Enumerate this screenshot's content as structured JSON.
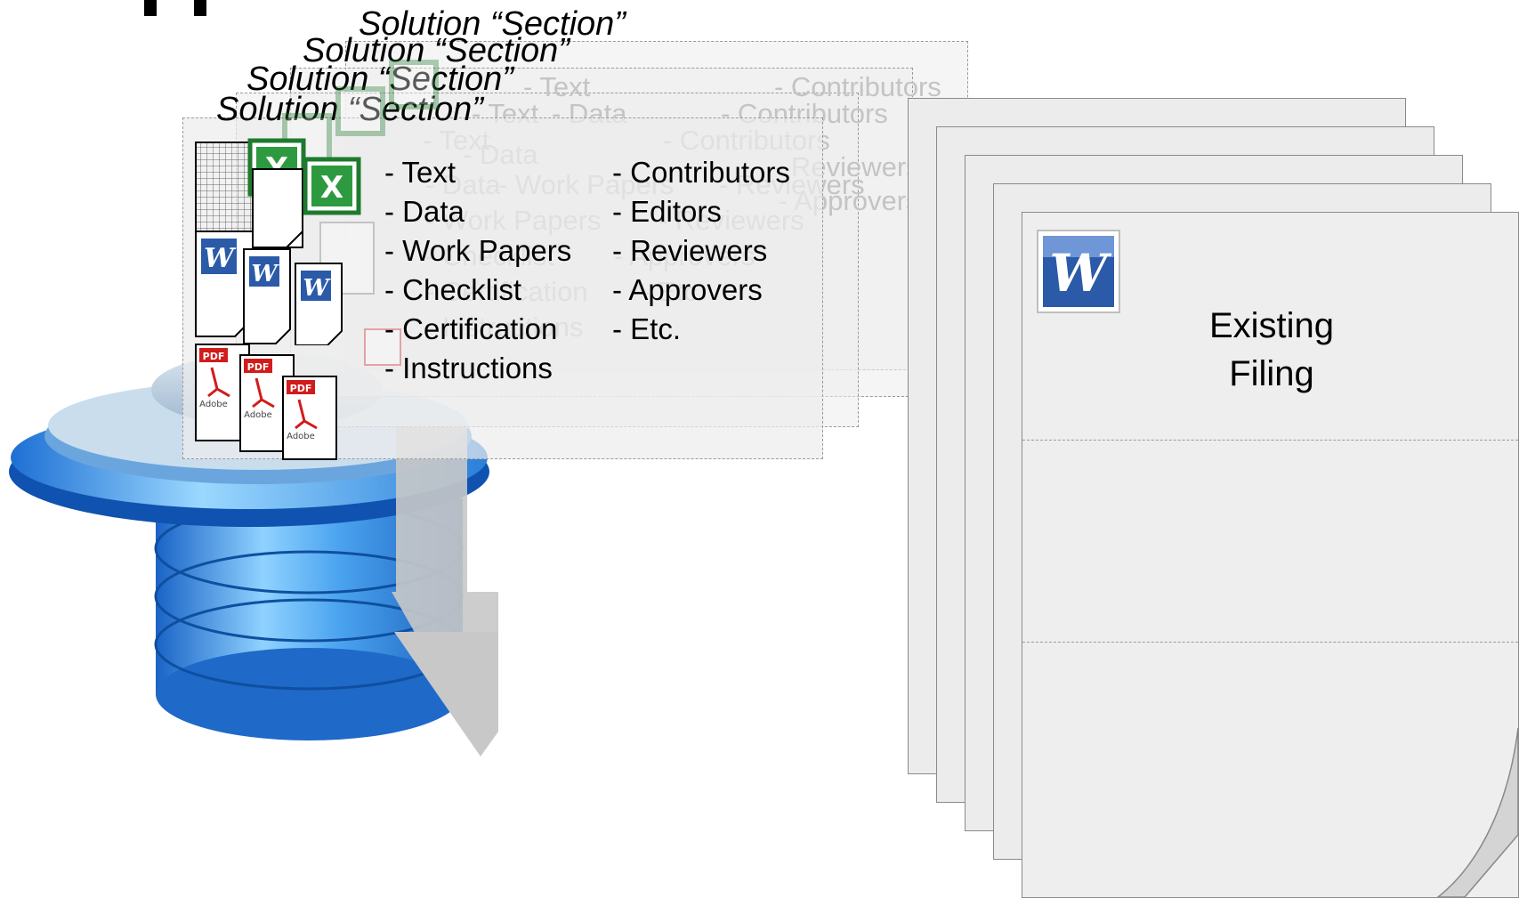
{
  "partial_title": "",
  "section_title": "Solution “Section”",
  "items_left": [
    "- Text",
    "- Data",
    "- Work Papers",
    "- Checklist",
    "- Certification",
    "- Instructions"
  ],
  "items_right": [
    "- Contributors",
    "- Editors",
    "- Reviewers",
    "- Approvers",
    "- Etc."
  ],
  "existing_filing": {
    "line1": "Existing",
    "line2": "Filing"
  },
  "icons": {
    "excel": "excel-file-icon",
    "word": "word-file-icon",
    "pdf": "pdf-file-icon",
    "spreadsheet": "spreadsheet-grid-icon",
    "database": "database-icon",
    "arrow": "down-arrow-icon"
  },
  "pdf_badge": "PDF",
  "pdf_brand": "Adobe",
  "colors": {
    "excel_green": "#1e7a2e",
    "word_blue": "#2b5aa8",
    "pdf_red": "#d21b1b",
    "db_blue": "#2f7fd6"
  }
}
